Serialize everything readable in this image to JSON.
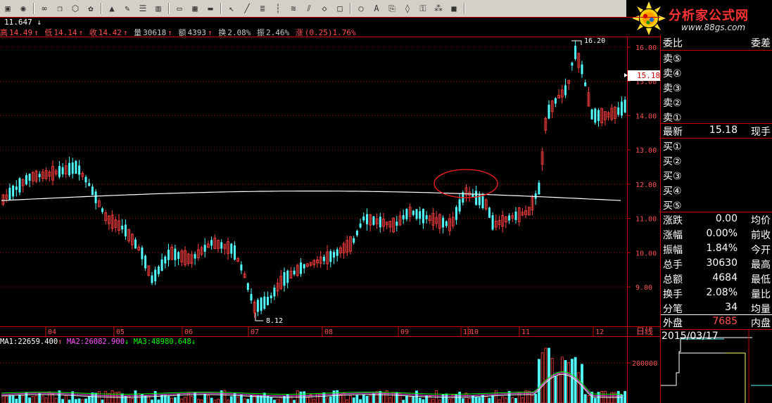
{
  "toolbar": {
    "icons": [
      "book-icon",
      "record-icon",
      "glasses-icon",
      "copy-icon",
      "cube-icon",
      "palette-icon",
      "alarm-icon",
      "wrench-icon",
      "layout-rows-icon",
      "layout-cols-icon",
      "window-icon",
      "chart-window-icon",
      "monitor-icon",
      "cursor-icon",
      "line-icon",
      "list-icon",
      "bars-icon",
      "fan-icon",
      "gann-icon",
      "channel-icon",
      "rect-icon",
      "ellipse-icon",
      "text-icon",
      "copy2-icon",
      "eraser-icon",
      "lock-icon",
      "color-grid-icon",
      "save-icon"
    ]
  },
  "logo": {
    "text": "分析家公式网",
    "url": "www.88gs.com"
  },
  "top_value": "11.647 ↓",
  "info": {
    "high_label": "高",
    "high": "14.49",
    "high_arrow": "↑",
    "low_label": "低",
    "low": "14.14",
    "low_arrow": "↑",
    "close_label": "收",
    "close": "14.42",
    "close_arrow": "↑",
    "volume_label": "量",
    "volume": "30618",
    "volume_arrow": "↑",
    "amount_label": "额",
    "amount": "4393",
    "amount_arrow": "↑",
    "turnover_label": "换",
    "turnover": "2.08%",
    "amplitude_label": "振",
    "amplitude": "2.46%",
    "change_label": "涨",
    "change": "(0.25)1.76%"
  },
  "chart_data": {
    "type": "candlestick",
    "price_axis": [
      {
        "label": "16.00",
        "value": 16.0
      },
      {
        "label": "15.00",
        "value": 15.0
      },
      {
        "label": "14.00",
        "value": 14.0
      },
      {
        "label": "13.00",
        "value": 13.0
      },
      {
        "label": "12.00",
        "value": 12.0
      },
      {
        "label": "11.00",
        "value": 11.0
      },
      {
        "label": "10.00",
        "value": 10.0
      },
      {
        "label": "9.00",
        "value": 9.0
      }
    ],
    "current_price": "15.18",
    "annotations": [
      {
        "label": "16.20",
        "value": 16.2
      },
      {
        "label": "8.12",
        "value": 8.12
      }
    ],
    "months": [
      "04",
      "05",
      "06",
      "07",
      "08",
      "09",
      "10",
      "10",
      "11",
      "12"
    ],
    "period_label": "日线",
    "volume_axis": [
      {
        "label": "200000",
        "value": 200000
      }
    ],
    "ma": {
      "ma1_label": "MA1:22659.400",
      "ma1_arrow": "↑",
      "ma2_label": "MA2:26082.900",
      "ma2_arrow": "↓",
      "ma3_label": "MA3:48980.648",
      "ma3_arrow": "↓"
    }
  },
  "panel": {
    "header": {
      "left": "委比",
      "right": "委差"
    },
    "sell": [
      "卖⑤",
      "卖④",
      "卖③",
      "卖②",
      "卖①"
    ],
    "latest": {
      "label": "最新",
      "value": "15.18",
      "right": "现手"
    },
    "buy": [
      "买①",
      "买②",
      "买③",
      "买④",
      "买⑤"
    ],
    "stats": [
      {
        "label": "涨跌",
        "value": "0.00",
        "right": "均价"
      },
      {
        "label": "涨幅",
        "value": "0.00%",
        "right": "前收"
      },
      {
        "label": "振幅",
        "value": "1.84%",
        "right": "今开"
      },
      {
        "label": "总手",
        "value": "30630",
        "right": "最高"
      },
      {
        "label": "总额",
        "value": "4684",
        "right": "最低"
      },
      {
        "label": "换手",
        "value": "2.08%",
        "right": "量比"
      },
      {
        "label": "分笔",
        "value": "34",
        "right": "均量"
      }
    ],
    "outer": {
      "label": "外盘",
      "value": "7685",
      "right": "内盘"
    },
    "date": "2015/03/17"
  }
}
